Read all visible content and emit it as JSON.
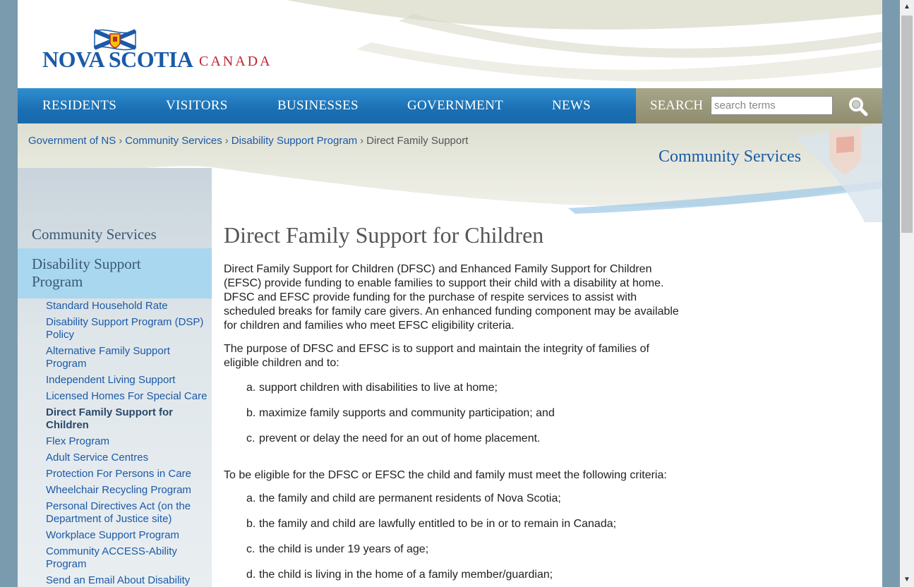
{
  "header": {
    "logo_word": "NOVA SCOTIA",
    "logo_country": "CANADA"
  },
  "nav": {
    "items": [
      {
        "label": "RESIDENTS"
      },
      {
        "label": "VISITORS"
      },
      {
        "label": "BUSINESSES"
      },
      {
        "label": "GOVERNMENT"
      },
      {
        "label": "NEWS"
      }
    ],
    "search_label": "SEARCH",
    "search_placeholder": "search terms"
  },
  "breadcrumb": {
    "items": [
      "Government of NS",
      "Community Services",
      "Disability Support Program"
    ],
    "current": "Direct Family Support",
    "separator": "›"
  },
  "department_title": "Community Services",
  "sidebar": {
    "top": "Community Services",
    "active_section": "Disability Support Program",
    "links": [
      "Standard Household Rate",
      "Disability Support Program (DSP) Policy",
      "Alternative Family Support Program",
      "Independent Living Support",
      "Licensed Homes For Special Care",
      "Direct Family Support for Children",
      "Flex Program",
      "Adult Service Centres",
      "Protection For Persons in Care",
      "Wheelchair Recycling Program",
      "Personal Directives Act (on the Department of Justice site)",
      "Workplace Support Program",
      "Community ACCESS-Ability Program",
      "Send an Email About Disability"
    ]
  },
  "content": {
    "title": "Direct Family Support for Children",
    "para1": "Direct Family Support for Children (DFSC) and Enhanced Family Support for Children (EFSC) provide funding to enable families to support their child with a disability at home. DFSC and EFSC provide funding for the purchase of respite services to assist with scheduled breaks for family care givers.  An enhanced funding component may be available for children and families who meet EFSC eligibility criteria.",
    "para2": "The purpose of DFSC and EFSC is to support and maintain the integrity of families of eligible children and to:",
    "purpose_list": [
      {
        "marker": "a.",
        "text": "support children with disabilities to live at home;"
      },
      {
        "marker": "b.",
        "text": "maximize family supports and community participation; and"
      },
      {
        "marker": "c.",
        "text": "prevent or delay the need for an out of home placement."
      }
    ],
    "para3": "To be eligible for the DFSC or EFSC the child and family must meet the following criteria:",
    "criteria_list": [
      {
        "marker": "a.",
        "text": "the family and child are permanent residents of Nova Scotia;"
      },
      {
        "marker": "b.",
        "text": "the family and child are lawfully entitled to be in or to remain in Canada;"
      },
      {
        "marker": "c.",
        "text": "the child is under 19 years of age;"
      },
      {
        "marker": "d.",
        "text": "the child is living in the home of a family member/guardian;"
      }
    ]
  },
  "colors": {
    "brand_blue": "#1a5aa8",
    "canada_red": "#c0232e",
    "nav_blue": "#1a6fb3",
    "search_olive": "#8f8d6e",
    "sidebar_active": "#a8d7ef"
  },
  "icons": {
    "search": "magnifier-icon",
    "flag": "nova-scotia-flag-icon"
  }
}
